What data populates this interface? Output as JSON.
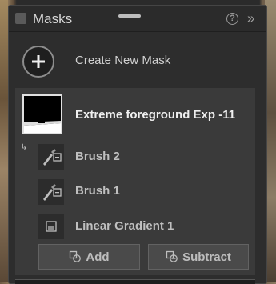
{
  "panel": {
    "title": "Masks",
    "help_symbol": "?",
    "expand_symbol": "»"
  },
  "create": {
    "label": "Create New Mask"
  },
  "mask": {
    "name": "Extreme foreground Exp -11",
    "link_symbol": "↳",
    "components": [
      {
        "label": "Brush 2",
        "icon": "brush-icon"
      },
      {
        "label": "Brush 1",
        "icon": "brush-icon"
      },
      {
        "label": "Linear Gradient 1",
        "icon": "linear-gradient-icon"
      }
    ]
  },
  "actions": {
    "add_label": "Add",
    "subtract_label": "Subtract"
  },
  "colors": {
    "panel_bg": "#2d2d2d",
    "selected_bg": "#3a3a3a",
    "text": "#d0d0d0"
  }
}
